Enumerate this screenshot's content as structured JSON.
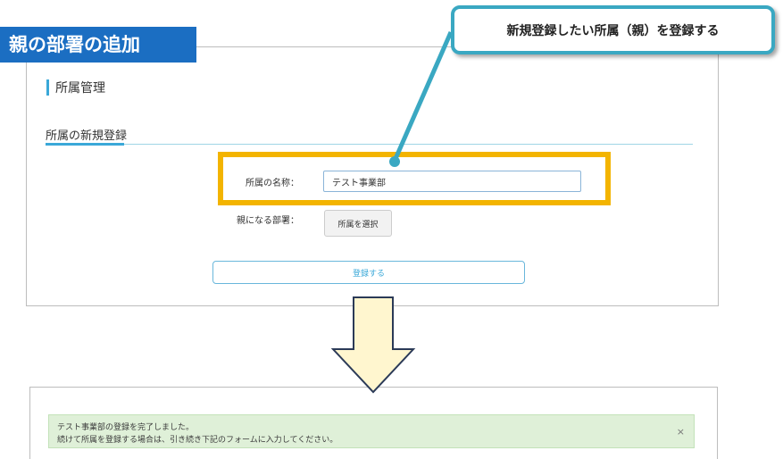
{
  "heading": "親の部署の追加",
  "callout": "新規登録したい所属（親）を登録する",
  "page": {
    "title": "所属管理",
    "section_title": "所属の新規登録"
  },
  "form": {
    "name_label": "所属の名称：",
    "name_value": "テスト事業部",
    "parent_label": "親になる部署：",
    "select_button": "所属を選択",
    "submit_button": "登録する"
  },
  "alert": {
    "line1": "テスト事業部の登録を完了しました。",
    "line2": "続けて所属を登録する場合は、引き続き下記のフォームに入力してください。",
    "close": "×"
  },
  "colors": {
    "heading_bg": "#1b6ec2",
    "highlight": "#f3b400",
    "callout_border": "#3aa8c2",
    "arrow_fill": "#fff6cf",
    "arrow_stroke": "#2b3a57",
    "success_bg": "#dff0d8"
  }
}
